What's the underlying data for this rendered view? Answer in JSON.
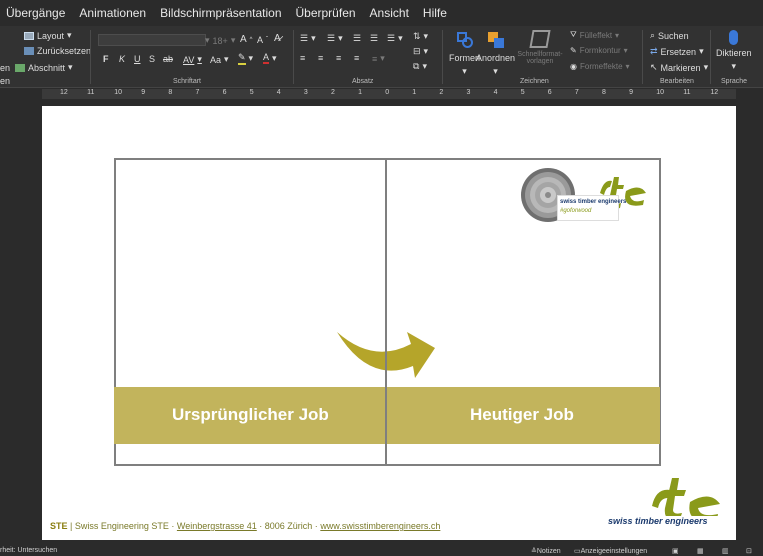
{
  "menu": [
    "Übergänge",
    "Animationen",
    "Bildschirmpräsentation",
    "Überprüfen",
    "Ansicht",
    "Hilfe"
  ],
  "ribbon": {
    "slides": {
      "layout": "Layout",
      "reset": "Zurücksetzen",
      "section": "Abschnitt",
      "cut_left": "en",
      "cut_left2": "en"
    },
    "font": {
      "label": "Schriftart",
      "size": "18+",
      "bold": "F",
      "italic": "K",
      "underline": "U",
      "shadow": "S",
      "strike": "ab",
      "spacing": "AV",
      "case": "Aa",
      "grow": "A",
      "shrink": "A"
    },
    "paragraph": {
      "label": "Absatz"
    },
    "drawing": {
      "label": "Zeichnen",
      "shapes": "Formen",
      "arrange": "Anordnen",
      "quickstyles": "Schnellformat-vorlagen",
      "fill": "Fülleffekt",
      "outline": "Formkontur",
      "effects": "Formeffekte"
    },
    "editing": {
      "label": "Bearbeiten",
      "find": "Suchen",
      "replace": "Ersetzen",
      "select": "Markieren"
    },
    "voice": {
      "label": "Sprache",
      "dictate": "Diktieren"
    }
  },
  "ruler": [
    "12",
    "11",
    "10",
    "9",
    "8",
    "7",
    "6",
    "5",
    "4",
    "3",
    "2",
    "1",
    "0",
    "1",
    "2",
    "3",
    "4",
    "5",
    "6",
    "7",
    "8",
    "9",
    "10",
    "11",
    "12"
  ],
  "slide": {
    "left_label": "Ursprünglicher Job",
    "right_label": "Heutiger Job",
    "logo_small_brand": "swiss timber engineers",
    "logo_small_tag": "#goforwood",
    "logo_main_brand": "swiss timber engineers",
    "footer": {
      "ste": "STE",
      "company": " | Swiss Engineering STE · ",
      "street": "Weinbergstrasse 41",
      "city": " · 8006 Zürich · ",
      "url": "www.swisstimberengineers.ch"
    }
  },
  "status": {
    "accessibility": "rheit: Untersuchen",
    "notes": "Notizen",
    "display": "Anzeigeeinstellungen"
  },
  "colors": {
    "accent_gold": "#c2b45c",
    "arrow_gold": "#b5a52a",
    "logo_green": "#8a9a1a",
    "word_blue": "#3a78d8"
  }
}
